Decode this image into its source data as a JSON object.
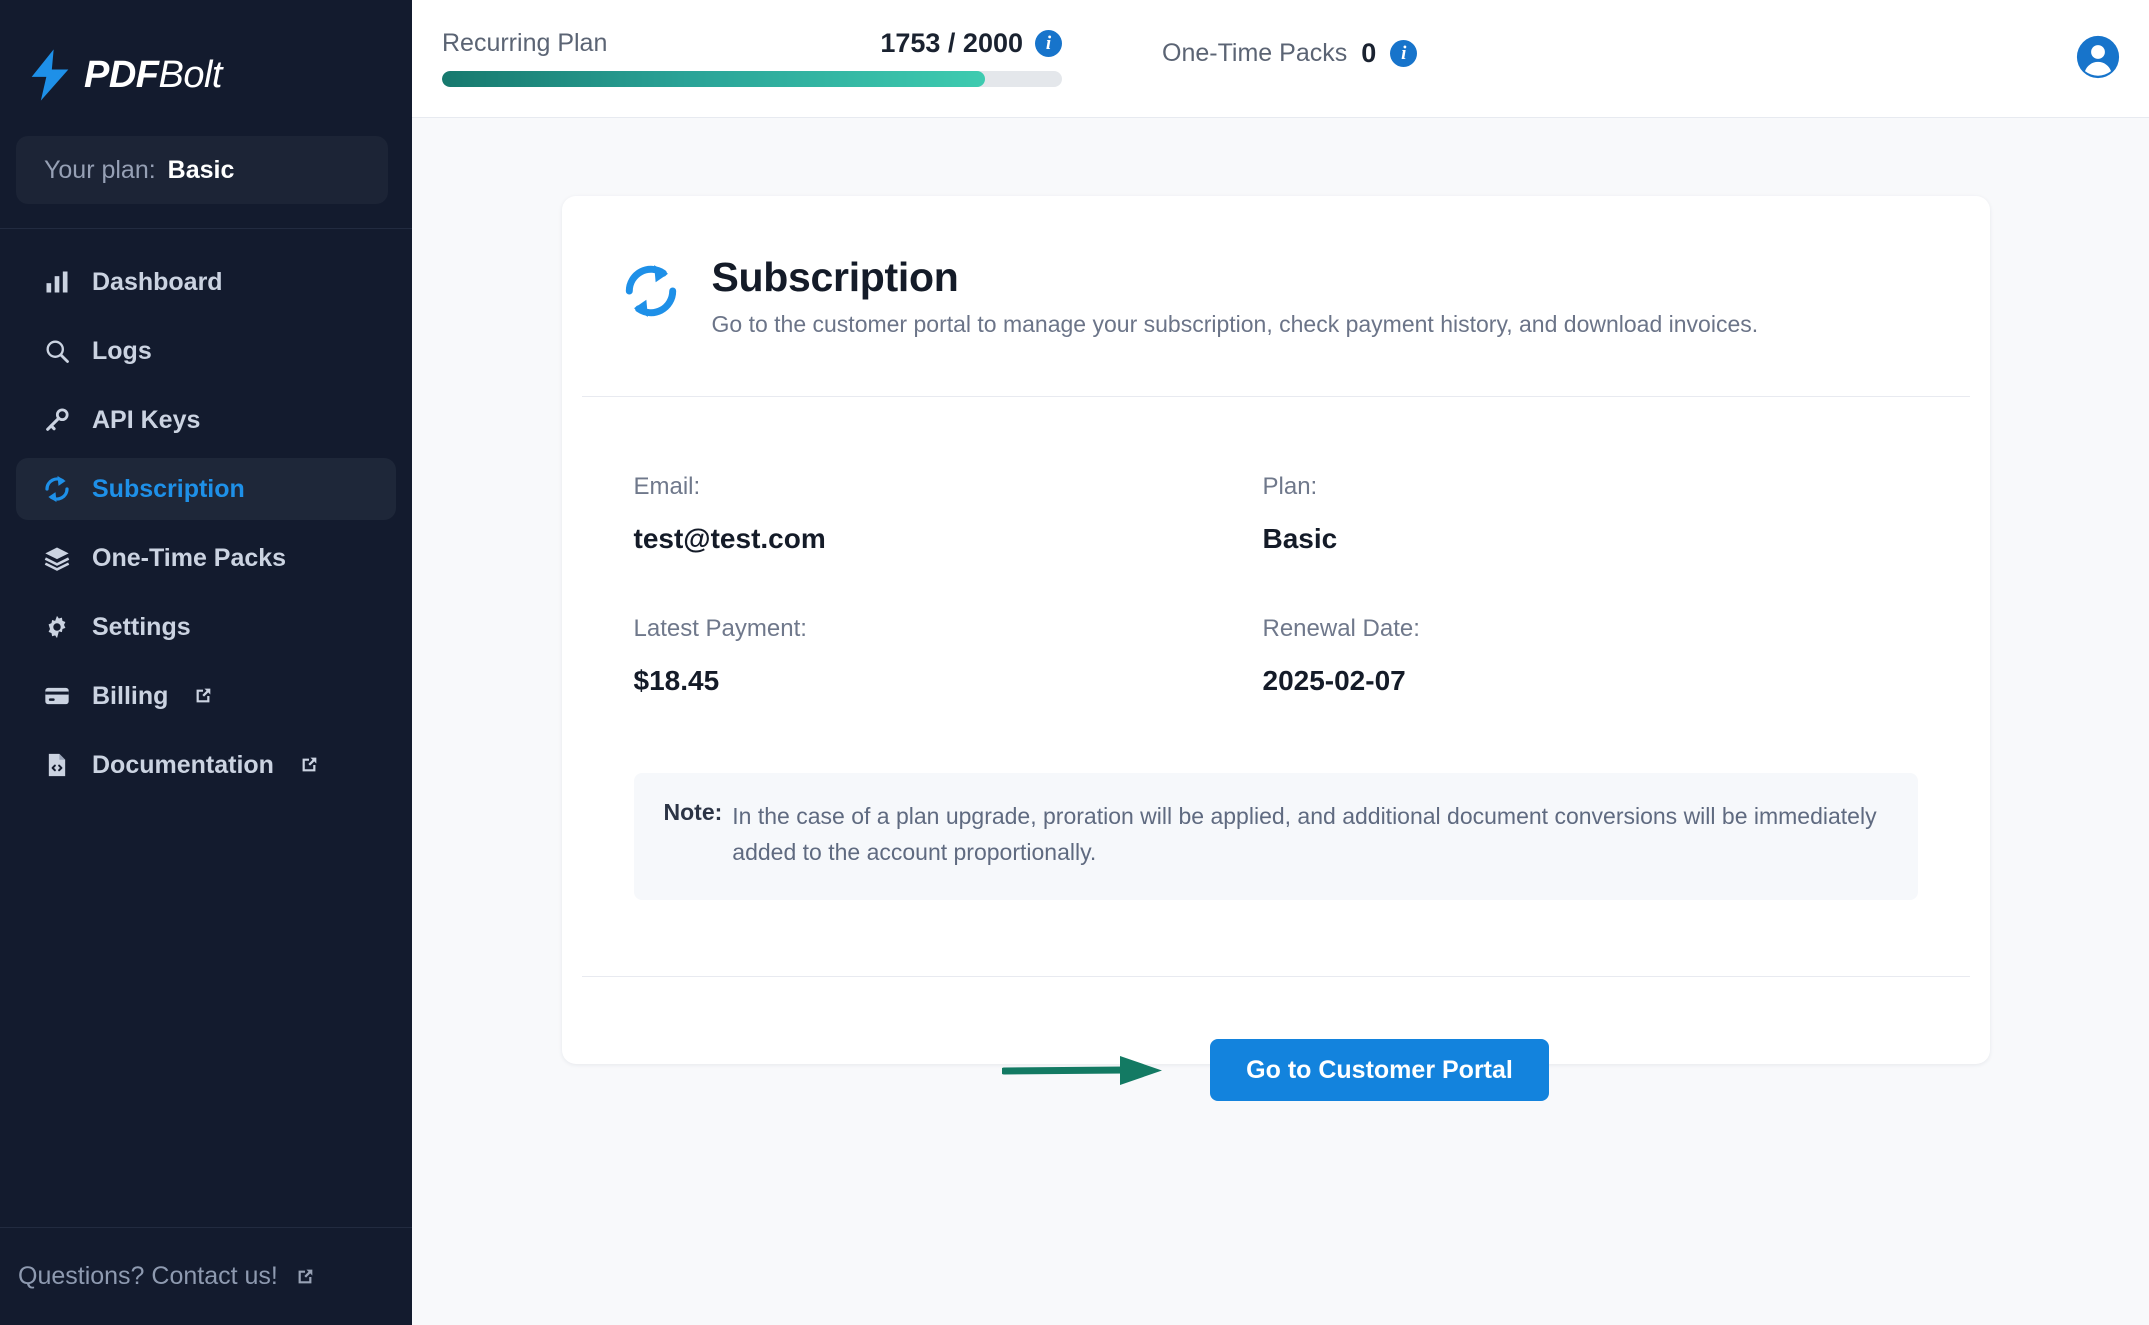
{
  "brand": {
    "name_bold": "PDF",
    "name_light": "Bolt",
    "logo_icon": "lightning-bolt-icon"
  },
  "sidebar": {
    "plan_label": "Your plan:",
    "plan_value": "Basic",
    "items": [
      {
        "label": "Dashboard",
        "icon": "bar-chart-icon",
        "active": false,
        "external": false
      },
      {
        "label": "Logs",
        "icon": "search-icon",
        "active": false,
        "external": false
      },
      {
        "label": "API Keys",
        "icon": "key-icon",
        "active": false,
        "external": false
      },
      {
        "label": "Subscription",
        "icon": "sync-icon",
        "active": true,
        "external": false
      },
      {
        "label": "One-Time Packs",
        "icon": "layers-icon",
        "active": false,
        "external": false
      },
      {
        "label": "Settings",
        "icon": "gear-icon",
        "active": false,
        "external": false
      },
      {
        "label": "Billing",
        "icon": "credit-card-icon",
        "active": false,
        "external": true
      },
      {
        "label": "Documentation",
        "icon": "file-code-icon",
        "active": false,
        "external": true
      }
    ],
    "footer_link": "Questions? Contact us!",
    "footer_icon": "external-link-icon"
  },
  "topbar": {
    "recurring": {
      "label": "Recurring Plan",
      "used": 1753,
      "total": 2000,
      "count_text": "1753 / 2000",
      "percent": 87.65,
      "info_icon": "info-icon"
    },
    "packs": {
      "label": "One-Time Packs",
      "count": "0",
      "info_icon": "info-icon"
    },
    "avatar_icon": "user-avatar-icon"
  },
  "card": {
    "icon": "sync-icon",
    "title": "Subscription",
    "subtitle": "Go to the customer portal to manage your subscription, check payment history, and download invoices.",
    "fields": [
      {
        "label": "Email:",
        "value": "test@test.com"
      },
      {
        "label": "Plan:",
        "value": "Basic"
      },
      {
        "label": "Latest Payment:",
        "value": "$18.45"
      },
      {
        "label": "Renewal Date:",
        "value": "2025-02-07"
      }
    ],
    "note_label": "Note:",
    "note_text": "In the case of a plan upgrade, proration will be applied, and additional document conversions will be immediately added to the account proportionally.",
    "cta_label": "Go to Customer Portal",
    "annotation_icon": "green-arrow-annotation"
  },
  "colors": {
    "sidebar_bg": "#131b2e",
    "accent_blue": "#1e90e8",
    "button_blue": "#1383dd",
    "progress_start": "#17796e",
    "progress_end": "#3ecbb0",
    "annotation_green": "#137a63",
    "page_bg": "#f8f9fb"
  }
}
